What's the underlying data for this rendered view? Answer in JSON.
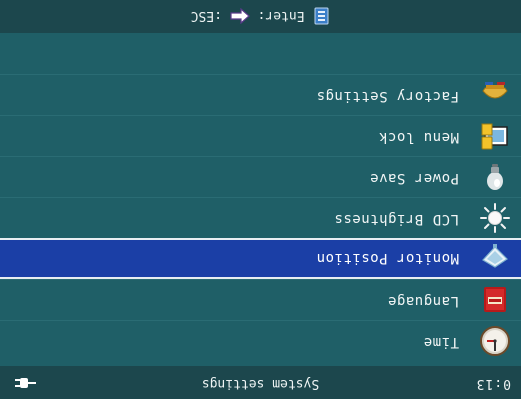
{
  "header": {
    "timer": "0:13",
    "title": "System settings",
    "power_icon": "power-plug-icon"
  },
  "menu": {
    "items": [
      {
        "label": "Time",
        "icon": "clock-icon",
        "selected": false
      },
      {
        "label": "Language",
        "icon": "dictionary-icon",
        "selected": false
      },
      {
        "label": "Monitor Position",
        "icon": "monitor-position-icon",
        "selected": true
      },
      {
        "label": "LCD Brightness",
        "icon": "sun-icon",
        "selected": false
      },
      {
        "label": "Power Save",
        "icon": "lightbulb-icon",
        "selected": false
      },
      {
        "label": "Menu lock",
        "icon": "lock-screen-icon",
        "selected": false
      },
      {
        "label": "Factory Settings",
        "icon": "factory-tools-icon",
        "selected": false
      }
    ]
  },
  "footer": {
    "enter_key": "Enter",
    "enter_sep": ":",
    "esc_key": "ESC",
    "esc_sep": ":",
    "enter_icon": "enter-key-icon",
    "esc_icon": "back-arrow-icon"
  },
  "colors": {
    "background": "#1f5f67",
    "bar": "#1c474d",
    "selection": "#1b3fa6",
    "text": "#f2f6f6"
  }
}
